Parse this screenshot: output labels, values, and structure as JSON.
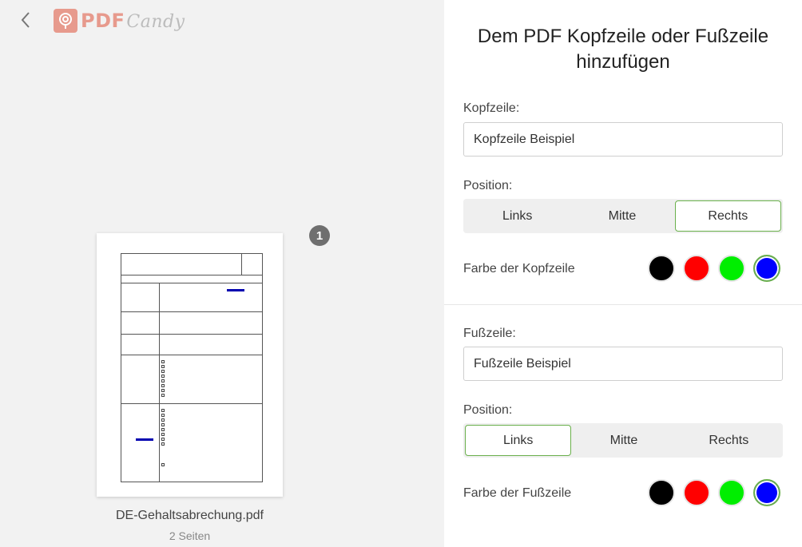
{
  "app": {
    "logo": {
      "pdf": "PDF",
      "candy": "Candy"
    }
  },
  "document": {
    "page_badge": "1",
    "file_name": "DE-Gehaltsabrechung.pdf",
    "pages": "2 Seiten"
  },
  "panel": {
    "title": "Dem PDF Kopfzeile oder Fußzeile hinzufügen",
    "header": {
      "label": "Kopfzeile:",
      "value": "Kopfzeile Beispiel",
      "position_label": "Position:",
      "positions": [
        "Links",
        "Mitte",
        "Rechts"
      ],
      "selected_position": "Rechts",
      "color_label": "Farbe der Kopfzeile",
      "colors": [
        "#000000",
        "#ff0000",
        "#00ee00",
        "#0000ff"
      ],
      "selected_color": "#0000ff"
    },
    "footer": {
      "label": "Fußzeile:",
      "value": "Fußzeile Beispiel",
      "position_label": "Position:",
      "positions": [
        "Links",
        "Mitte",
        "Rechts"
      ],
      "selected_position": "Links",
      "color_label": "Farbe der Fußzeile",
      "colors": [
        "#000000",
        "#ff0000",
        "#00ee00",
        "#0000ff"
      ],
      "selected_color": "#0000ff"
    }
  }
}
